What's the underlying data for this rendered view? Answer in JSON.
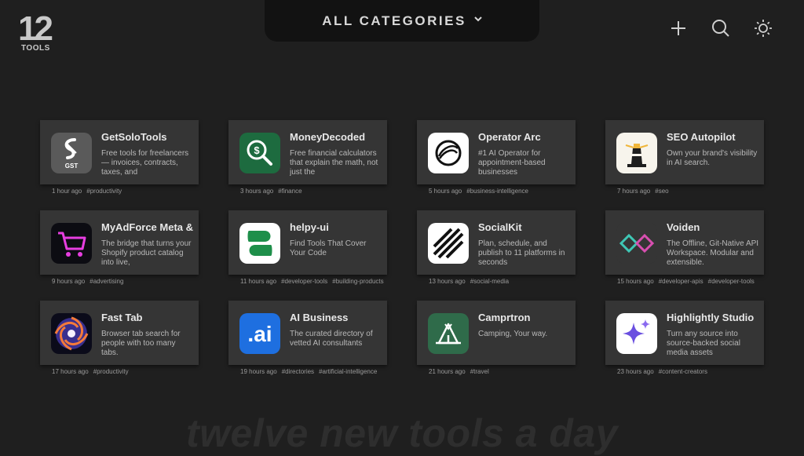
{
  "logo": {
    "number": "12",
    "sub": "TOOLS"
  },
  "header": {
    "category_label": "ALL CATEGORIES",
    "icons": [
      "plus-icon",
      "search-icon",
      "sun-icon"
    ]
  },
  "cards": [
    {
      "title": "GetSoloTools",
      "desc": "Free tools for freelancers — invoices, contracts, taxes, and",
      "time": "1 hour ago",
      "tags": [
        "#productivity"
      ],
      "icon": "getsolotools-logo-icon"
    },
    {
      "title": "MoneyDecoded",
      "desc": "Free financial calculators that explain the math, not just the",
      "time": "3 hours ago",
      "tags": [
        "#finance"
      ],
      "icon": "moneydecoded-logo-icon"
    },
    {
      "title": "Operator Arc",
      "desc": "#1 AI Operator for appointment-based businesses",
      "time": "5 hours ago",
      "tags": [
        "#business-intelligence"
      ],
      "icon": "operator-arc-logo-icon"
    },
    {
      "title": "SEO Autopilot",
      "desc": "Own your brand's visibility in AI search.",
      "time": "7 hours ago",
      "tags": [
        "#seo"
      ],
      "icon": "lighthouse-icon"
    },
    {
      "title": "MyAdForce Meta & IG",
      "desc": "The bridge that turns your Shopify product catalog into live,",
      "time": "9 hours ago",
      "tags": [
        "#advertising"
      ],
      "icon": "shopping-cart-icon"
    },
    {
      "title": "helpy-ui",
      "desc": "Find Tools That Cover Your Code",
      "time": "11 hours ago",
      "tags": [
        "#developer-tools",
        "#building-products"
      ],
      "icon": "helpy-ui-logo-icon"
    },
    {
      "title": "SocialKit",
      "desc": "Plan, schedule, and publish to 11 platforms in seconds",
      "time": "13 hours ago",
      "tags": [
        "#social-media"
      ],
      "icon": "stripes-icon"
    },
    {
      "title": "Voiden",
      "desc": "The Offline, Git-Native API Workspace. Modular and extensible.",
      "time": "15 hours ago",
      "tags": [
        "#developer-apis",
        "#developer-tools"
      ],
      "icon": "infinity-icon"
    },
    {
      "title": "Fast Tab",
      "desc": "Browser tab search for people with too many tabs.",
      "time": "17 hours ago",
      "tags": [
        "#productivity"
      ],
      "icon": "swirl-icon"
    },
    {
      "title": "AI Business",
      "desc": "The curated directory of vetted AI consultants",
      "time": "19 hours ago",
      "tags": [
        "#directories",
        "#artificial-intelligence"
      ],
      "icon": "ai-logo-icon",
      "icon_text": ".ai"
    },
    {
      "title": "Camprtron",
      "desc": "Camping, Your way.",
      "time": "21 hours ago",
      "tags": [
        "#travel"
      ],
      "icon": "tent-icon"
    },
    {
      "title": "Highlightly Studio",
      "desc": "Turn any source into source-backed social media assets",
      "time": "23 hours ago",
      "tags": [
        "#content-creators"
      ],
      "icon": "sparkle-icon"
    }
  ],
  "tagline": "twelve new tools a day",
  "colors": {
    "background": "#1f1f1f",
    "card": "#353535",
    "header_tab": "#121212"
  }
}
